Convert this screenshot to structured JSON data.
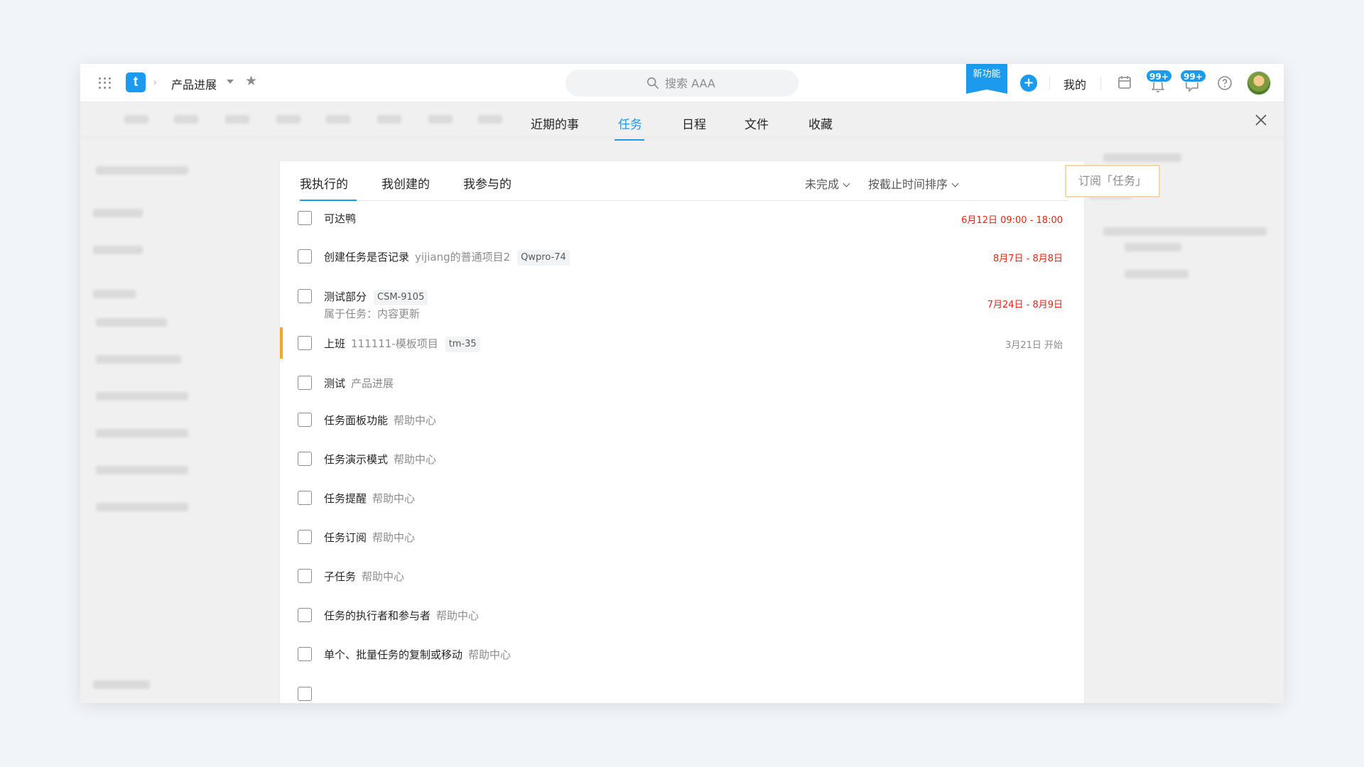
{
  "header": {
    "project_name": "产品进展",
    "search_placeholder": "搜索 AAA",
    "new_feature_label": "新功能",
    "plus_label": "+",
    "mine_label": "我的",
    "notifications_badge": "99+",
    "messages_badge": "99+"
  },
  "nav_tabs": [
    "近期的事",
    "任务",
    "日程",
    "文件",
    "收藏"
  ],
  "sub_tabs": [
    "我执行的",
    "我创建的",
    "我参与的"
  ],
  "filters": {
    "status_label": "未完成",
    "sort_label": "按截止时间排序",
    "subscribe_label": "订阅「任务」"
  },
  "tasks": [
    {
      "title": "可达鸭",
      "project": "",
      "tag": "",
      "sub": "",
      "date": "6月12日 09:00 - 18:00",
      "date_color": "red"
    },
    {
      "title": "创建任务是否记录",
      "project": "yijiang的普通项目2",
      "tag": "Qwpro-74",
      "sub": "",
      "date": "8月7日 - 8月8日",
      "date_color": "red"
    },
    {
      "title": "测试部分",
      "project": "",
      "tag": "CSM-9105",
      "sub": "属于任务：内容更新",
      "date": "7月24日 - 8月9日",
      "date_color": "red"
    },
    {
      "title": "上班",
      "project": "111111-模板项目",
      "tag": "tm-35",
      "sub": "",
      "date": "3月21日 开始",
      "date_color": "gray"
    },
    {
      "title": "测试",
      "project": "产品进展",
      "tag": "",
      "sub": "",
      "date": "",
      "date_color": ""
    },
    {
      "title": "任务面板功能",
      "project": "帮助中心",
      "tag": "",
      "sub": "",
      "date": "",
      "date_color": ""
    },
    {
      "title": "任务演示模式",
      "project": "帮助中心",
      "tag": "",
      "sub": "",
      "date": "",
      "date_color": ""
    },
    {
      "title": "任务提醒",
      "project": "帮助中心",
      "tag": "",
      "sub": "",
      "date": "",
      "date_color": ""
    },
    {
      "title": "任务订阅",
      "project": "帮助中心",
      "tag": "",
      "sub": "",
      "date": "",
      "date_color": ""
    },
    {
      "title": "子任务",
      "project": "帮助中心",
      "tag": "",
      "sub": "",
      "date": "",
      "date_color": ""
    },
    {
      "title": "任务的执行者和参与者",
      "project": "帮助中心",
      "tag": "",
      "sub": "",
      "date": "",
      "date_color": ""
    },
    {
      "title": "单个、批量任务的复制或移动",
      "project": "帮助中心",
      "tag": "",
      "sub": "",
      "date": "",
      "date_color": ""
    }
  ],
  "colors": {
    "accent": "#1b9aee",
    "due_red": "#e62412",
    "priority_orange": "#f5a623"
  }
}
